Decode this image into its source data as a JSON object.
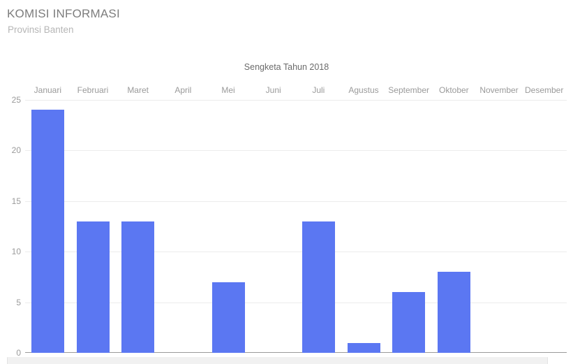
{
  "header": {
    "title": "KOMISI INFORMASI",
    "subtitle": "Provinsi Banten"
  },
  "colors": {
    "bar": "#5b77f2",
    "gridline": "#ececec",
    "axis": "#9a9a9a",
    "tick_text": "#9a9a9a",
    "title_text": "#7d7d7d",
    "subtitle_text": "#b6b6b6",
    "chart_title_text": "#6b6b6b",
    "background": "#ffffff"
  },
  "chart_data": {
    "type": "bar",
    "title": "Sengketa Tahun 2018",
    "xlabel": "",
    "ylabel": "",
    "categories": [
      "Januari",
      "Februari",
      "Maret",
      "April",
      "Mei",
      "Juni",
      "Juli",
      "Agustus",
      "September",
      "Oktober",
      "November",
      "Desember"
    ],
    "values": [
      24,
      13,
      13,
      0,
      7,
      0,
      13,
      1,
      6,
      8,
      0,
      0
    ],
    "series": [
      {
        "name": "Sengketa",
        "values": [
          24,
          13,
          13,
          0,
          7,
          0,
          13,
          1,
          6,
          8,
          0,
          0
        ]
      }
    ],
    "ylim": [
      0,
      25
    ],
    "yticks": [
      0,
      5,
      10,
      15,
      20,
      25
    ],
    "ytick_labels": [
      "0",
      "5",
      "10",
      "15",
      "20",
      "25"
    ],
    "grid": true,
    "xaxis_labels_position": "top",
    "legend": "none",
    "bar_color": "#5b77f2"
  },
  "scrollbar": {
    "name": "horizontal-scrollbar"
  }
}
